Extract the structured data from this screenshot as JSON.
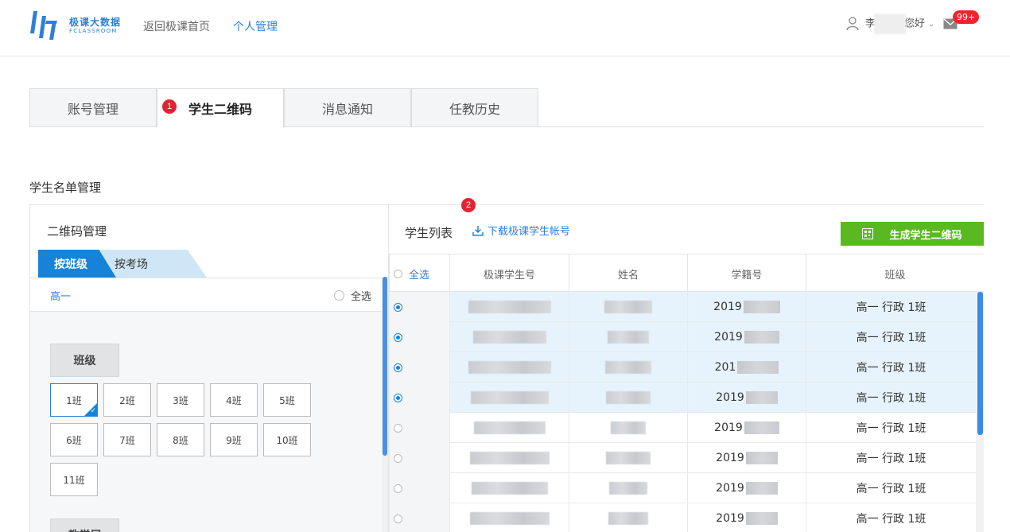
{
  "header": {
    "logo_cn": "极课大数据",
    "logo_en": "FCLASSROOM",
    "nav": [
      {
        "label": "返回极课首页",
        "active": false
      },
      {
        "label": "个人管理",
        "active": true
      }
    ],
    "user_prefix": "李",
    "user_suffix": "您好",
    "mail_badge": "99+"
  },
  "tabs": [
    {
      "label": "账号管理",
      "active": false
    },
    {
      "label": "学生二维码",
      "active": true
    },
    {
      "label": "消息通知",
      "active": false
    },
    {
      "label": "任教历史",
      "active": false
    }
  ],
  "steps": [
    "1",
    "2"
  ],
  "section_title": "学生名单管理",
  "left": {
    "title": "二维码管理",
    "subtabs": [
      "按班级",
      "按考场"
    ],
    "grade": "高一",
    "select_all": "全选",
    "group_label": "班级",
    "classes": [
      "1班",
      "2班",
      "3班",
      "4班",
      "5班",
      "6班",
      "7班",
      "8班",
      "9班",
      "10班",
      "11班"
    ],
    "selected_class": "1班",
    "next_group_label": "教学层"
  },
  "right": {
    "title": "学生列表",
    "download_label": "下载极课学生帐号",
    "generate_label": "生成学生二维码",
    "columns": [
      "全选",
      "极课学生号",
      "姓名",
      "学籍号",
      "班级"
    ],
    "rows": [
      {
        "selected": true,
        "xueji": "2019",
        "class": "高一 行政 1班"
      },
      {
        "selected": true,
        "xueji": "2019",
        "class": "高一 行政 1班"
      },
      {
        "selected": true,
        "xueji": "201",
        "class": "高一 行政 1班"
      },
      {
        "selected": true,
        "xueji": "2019",
        "class": "高一 行政 1班"
      },
      {
        "selected": false,
        "xueji": "2019",
        "class": "高一 行政 1班"
      },
      {
        "selected": false,
        "xueji": "2019",
        "class": "高一 行政 1班"
      },
      {
        "selected": false,
        "xueji": "2019",
        "class": "高一 行政 1班"
      },
      {
        "selected": false,
        "xueji": "2019",
        "class": "高一 行政 1班"
      }
    ]
  },
  "colors": {
    "accent": "#2f7fd7",
    "primary_tab": "#1683d8",
    "generate_green": "#5ab920",
    "badge_red": "#f5222d",
    "selected_row": "#e6f3fc"
  }
}
